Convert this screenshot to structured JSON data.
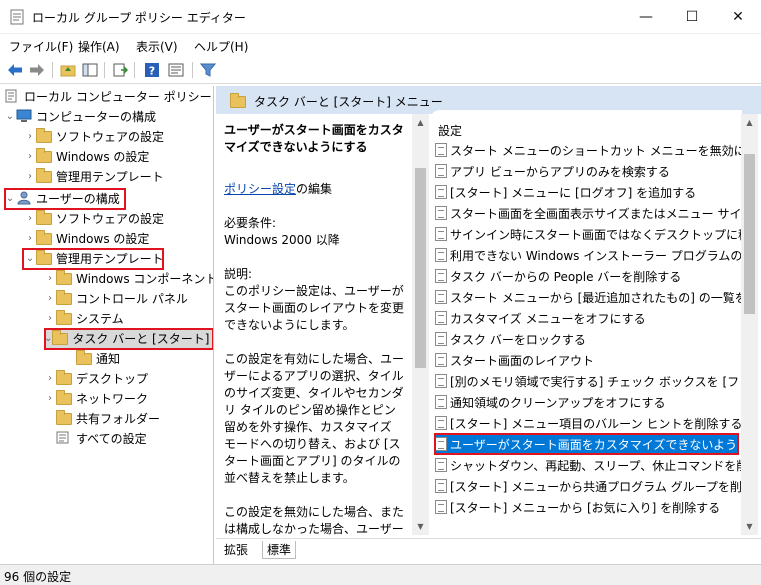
{
  "window": {
    "title": "ローカル グループ ポリシー エディター",
    "controls": {
      "minimize": "—",
      "maximize": "☐",
      "close": "✕"
    }
  },
  "menu": [
    "ファイル(F)",
    "操作(A)",
    "表示(V)",
    "ヘルプ(H)"
  ],
  "toolbar": [
    "back-icon",
    "forward-icon",
    "folder-up-icon",
    "show-tree-icon",
    "export-icon",
    "help-icon",
    "properties-icon",
    "filter-icon"
  ],
  "tree": [
    {
      "label": "ローカル コンピューター ポリシー",
      "arrow": "",
      "icon": "policy-icon"
    },
    {
      "label": "コンピューターの構成",
      "arrow": "⌄",
      "icon": "computer-icon"
    },
    {
      "label": "ソフトウェアの設定",
      "arrow": "›",
      "icon": "folder-icon"
    },
    {
      "label": "Windows の設定",
      "arrow": "›",
      "icon": "folder-icon"
    },
    {
      "label": "管理用テンプレート",
      "arrow": "›",
      "icon": "folder-icon"
    },
    {
      "label": "ユーザーの構成",
      "arrow": "⌄",
      "icon": "user-icon"
    },
    {
      "label": "ソフトウェアの設定",
      "arrow": "›",
      "icon": "folder-icon"
    },
    {
      "label": "Windows の設定",
      "arrow": "›",
      "icon": "folder-icon"
    },
    {
      "label": "管理用テンプレート",
      "arrow": "⌄",
      "icon": "folder-icon"
    },
    {
      "label": "Windows コンポーネント",
      "arrow": "›",
      "icon": "folder-icon"
    },
    {
      "label": "コントロール パネル",
      "arrow": "›",
      "icon": "folder-icon"
    },
    {
      "label": "システム",
      "arrow": "›",
      "icon": "folder-icon"
    },
    {
      "label": "タスク バーと [スタート] メ",
      "arrow": "⌄",
      "icon": "folder-icon"
    },
    {
      "label": "通知",
      "arrow": "",
      "icon": "folder-icon"
    },
    {
      "label": "デスクトップ",
      "arrow": "›",
      "icon": "folder-icon"
    },
    {
      "label": "ネットワーク",
      "arrow": "›",
      "icon": "folder-icon"
    },
    {
      "label": "共有フォルダー",
      "arrow": "",
      "icon": "folder-icon"
    },
    {
      "label": "すべての設定",
      "arrow": "",
      "icon": "all-settings-icon"
    }
  ],
  "header": {
    "title": "タスク バーと [スタート] メニュー"
  },
  "description": {
    "title": "ユーザーがスタート画面をカスタマイズできないようにする",
    "edit_link": "ポリシー設定",
    "edit_suffix": "の編集",
    "req_label": "必要条件:",
    "req_value": "Windows 2000 以降",
    "desc_label": "説明:",
    "p1": "このポリシー設定は、ユーザーがスタート画面のレイアウトを変更できないようにします。",
    "p2": "この設定を有効にした場合、ユーザーによるアプリの選択、タイルのサイズ変更、タイルやセカンダリ タイルのピン留め操作とピン留めを外す操作、カスタマイズ モードへの切り替え、および [スタート画面とアプリ] のタイルの並べ替えを禁止します。",
    "p3": "この設定を無効にした場合、または構成しなかった場合、ユーザーによるアプリの選択、タイルのサイズ変更、タイルやセカンダリ タイルのピン留め"
  },
  "list": {
    "column": "設定",
    "items": [
      "スタート メニューのショートカット メニューを無効にする",
      "アプリ ビューからアプリのみを検索する",
      "[スタート] メニューに [ログオフ] を追加する",
      "スタート画面を全画面表示サイズまたはメニュー サイズに強",
      "サインイン時にスタート画面ではなくデスクトップに移動する",
      "利用できない Windows インストーラー プログラムの [スタ",
      "タスク バーからの People バーを削除する",
      "スタート メニューから [最近追加されたもの] の一覧を削除",
      "カスタマイズ メニューをオフにする",
      "タスク バーをロックする",
      "スタート画面のレイアウト",
      "[別のメモリ領域で実行する] チェック ボックスを [ファイル",
      "通知領域のクリーンアップをオフにする",
      "[スタート] メニュー項目のバルーン ヒントを削除する",
      "ユーザーがスタート画面をカスタマイズできないようにする",
      "シャットダウン、再起動、スリープ、休止コマンドを削除して",
      "[スタート] メニューから共通プログラム グループを削除する",
      "[スタート] メニューから [お気に入り] を削除する"
    ],
    "selected_index": 14
  },
  "tabs": [
    "拡張",
    "標準"
  ],
  "status": "96 個の設定",
  "colors": {
    "selection": "#0078d7",
    "highlight_box": "#e0141e",
    "header_band": "#d7e4f4",
    "link": "#0645ad"
  }
}
